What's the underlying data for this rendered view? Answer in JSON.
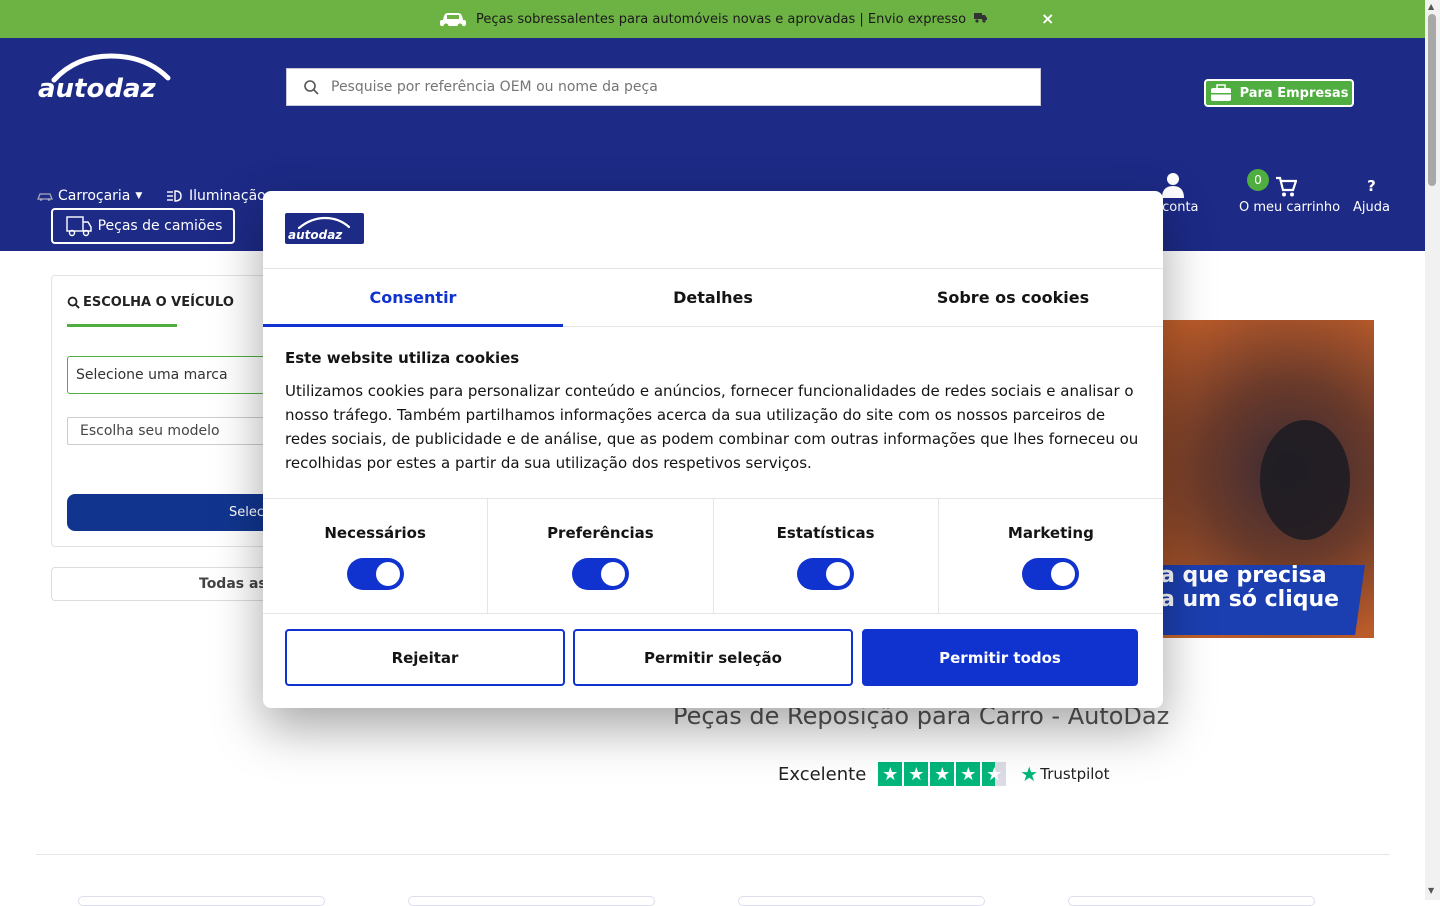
{
  "promo": {
    "text": "Peças sobressalentes para automóveis novas e aprovadas | Envio expresso",
    "close": "×"
  },
  "header": {
    "logo_text": "autodaz",
    "search_placeholder": "Pesquise por referência OEM ou nome da peça",
    "business_label": "Para Empresas",
    "categories": [
      {
        "label": "Carroçaria",
        "icon": "car-body-icon"
      },
      {
        "label": "Iluminação",
        "icon": "headlight-icon"
      }
    ],
    "truck_parts_label": "Peças de camiões",
    "account_label": "a conta",
    "cart_label": "O meu carrinho",
    "cart_count": "0",
    "help_icon": "?",
    "help_label": "Ajuda"
  },
  "vehicle_selector": {
    "title": "ESCOLHA O VEÍCULO",
    "brand_placeholder": "Selecione uma marca",
    "model_placeholder": "Escolha seu modelo",
    "select_button_partial": "Selec",
    "all_button_partial": "Todas as"
  },
  "banner": {
    "line1": "a que precisa",
    "line2": "a um só clique"
  },
  "main": {
    "title": "Peças de Reposição para Carro - AutoDaz",
    "rating_label": "Excelente",
    "trustpilot": "Trustpilot",
    "rating_stars": 4.5
  },
  "cookie_modal": {
    "logo_text": "autodaz",
    "tabs": [
      {
        "label": "Consentir",
        "active": true
      },
      {
        "label": "Detalhes",
        "active": false
      },
      {
        "label": "Sobre os cookies",
        "active": false
      }
    ],
    "heading": "Este website utiliza cookies",
    "body": "Utilizamos cookies para personalizar conteúdo e anúncios, fornecer funcionalidades de redes sociais e analisar o nosso tráfego. Também partilhamos informações acerca da sua utilização do site com os nossos parceiros de redes sociais, de publicidade e de análise, que as podem combinar com outras informações que lhes forneceu ou recolhidas por estes a partir da sua utilização dos respetivos serviços.",
    "categories": [
      {
        "label": "Necessários",
        "enabled": true
      },
      {
        "label": "Preferências",
        "enabled": true
      },
      {
        "label": "Estatísticas",
        "enabled": true
      },
      {
        "label": "Marketing",
        "enabled": true
      }
    ],
    "buttons": {
      "reject": "Rejeitar",
      "allow_selection": "Permitir seleção",
      "allow_all": "Permitir todos"
    }
  },
  "colors": {
    "promo_green": "#6db344",
    "header_blue": "#1d2a86",
    "accent_blue": "#1032cf",
    "brand_green": "#4fae3f"
  }
}
